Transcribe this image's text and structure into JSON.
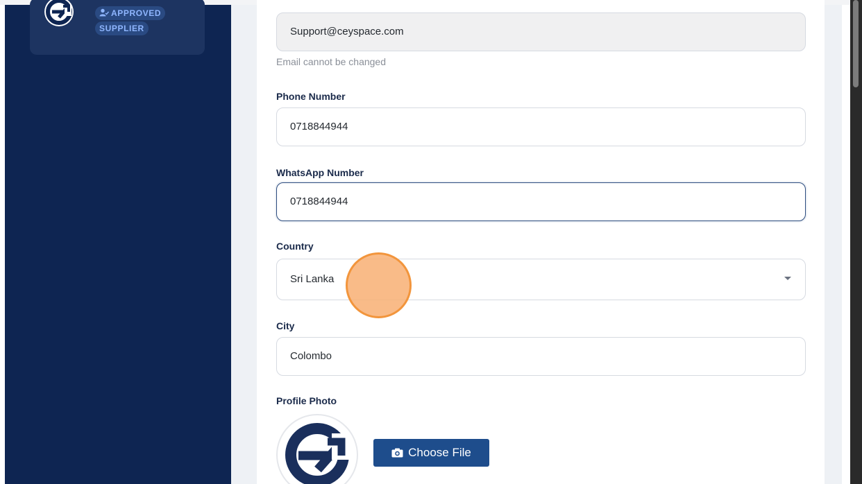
{
  "sidebar": {
    "badge_line1": "APPROVED",
    "badge_line2": "SUPPLIER",
    "avatar_icon": "ceyspace-logo-icon",
    "badge_icon": "user-check-icon"
  },
  "form": {
    "email": {
      "value": "Support@ceyspace.com",
      "helper": "Email cannot be changed"
    },
    "phone": {
      "label": "Phone Number",
      "value": "0718844944"
    },
    "whatsapp": {
      "label": "WhatsApp Number",
      "value": "0718844944"
    },
    "country": {
      "label": "Country",
      "value": "Sri Lanka"
    },
    "city": {
      "label": "City",
      "value": "Colombo"
    },
    "profile_photo": {
      "label": "Profile Photo",
      "button_label": "Choose File",
      "button_icon": "camera-icon"
    }
  },
  "colors": {
    "sidebar_bg": "#0e2552",
    "accent": "#1e4d8c",
    "click_indicator": "#f2953c"
  }
}
